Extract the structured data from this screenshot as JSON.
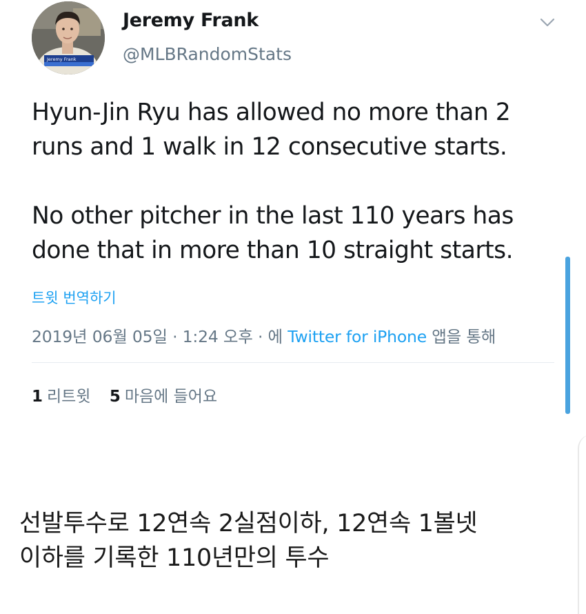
{
  "tweet": {
    "author": {
      "name": "Jeremy Frank",
      "handle": "@MLBRandomStats",
      "avatar_caption": "Jeremy Frank"
    },
    "text": {
      "line1": "Hyun-Jin Ryu has allowed no more than 2",
      "line2": "runs and 1 walk in 12 consecutive starts.",
      "line3": "No other pitcher in the last 110 years has",
      "line4": "done that in more than 10 straight starts."
    },
    "translate_label": "트윗 번역하기",
    "meta": {
      "date": "2019년 06월 05일",
      "separator1": " · ",
      "time": "1:24 오후",
      "separator2": " · ",
      "via_prefix": "에 ",
      "source": "Twitter for iPhone",
      "via_suffix": " 앱을 통해"
    },
    "stats": {
      "retweets_count": "1",
      "retweets_label": "리트윗",
      "likes_count": "5",
      "likes_label": "마음에 들어요"
    }
  },
  "caption": {
    "line1": "선발투수로 12연속 2실점이하, 12연속 1볼넷",
    "line2": "이하를 기록한 110년만의 투수"
  },
  "colors": {
    "text": "#14171a",
    "secondary": "#657786",
    "link": "#1da1f2",
    "divider": "#e6ecf0",
    "scroll_indicator": "#4aa3df"
  },
  "icons": {
    "menu": "chevron-down-icon"
  }
}
